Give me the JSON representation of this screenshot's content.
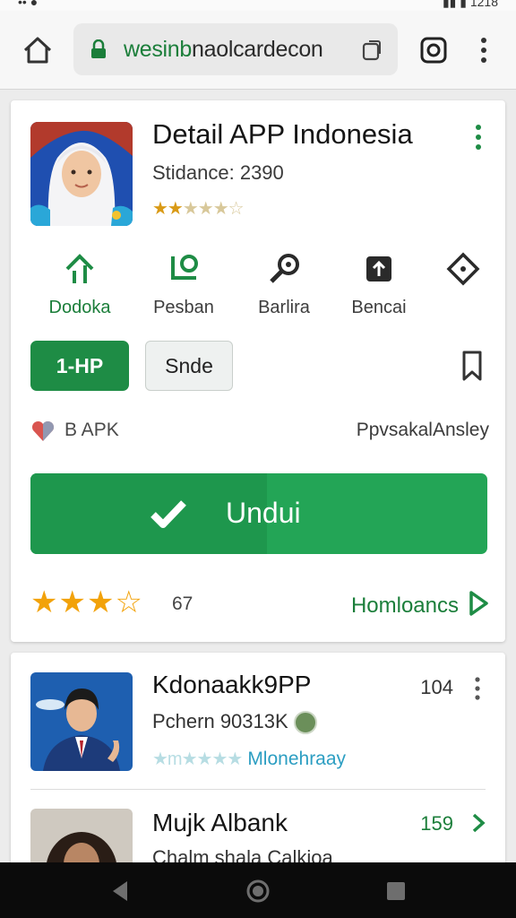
{
  "status_bar": {
    "left_text": "•• ●",
    "right_text": "▮▮ ▮ 1218"
  },
  "browser": {
    "url_host": "wesinb",
    "url_rest": "naolcardecon"
  },
  "app": {
    "title": "Detail APP Indonesia",
    "subtitle": "Stidance: 2390",
    "stars_filled": "★★",
    "stars_empty": "★★★☆"
  },
  "actions": [
    {
      "label": "Dodoka",
      "icon": "home-arrow-icon"
    },
    {
      "label": "Pesban",
      "icon": "pin-icon"
    },
    {
      "label": "Barlira",
      "icon": "key-icon"
    },
    {
      "label": "Bencai",
      "icon": "upload-icon"
    },
    {
      "label": "",
      "icon": "diamond-icon"
    }
  ],
  "buttons": {
    "primary_small": "1-HP",
    "secondary": "Snde"
  },
  "meta": {
    "left": "B APK",
    "right": "PpvsakalAnsley"
  },
  "download": {
    "label": "Undui"
  },
  "rating": {
    "stars": "★★★",
    "half_star": "☆",
    "count": "67",
    "homepage_label": "Homloancs"
  },
  "list": [
    {
      "name": "Kdonaakk9PP",
      "sub": "Pchern 90313K",
      "number": "104",
      "stars": "★m★★★★",
      "developer": "Mlonehraay"
    },
    {
      "name": "Mujk Albank",
      "sub": "Chalm shala Calkioa",
      "number": "159"
    }
  ],
  "colors": {
    "green": "#1e8c45",
    "download": "#23a556",
    "star": "#f2a20a",
    "link_green": "#1b7e3a"
  }
}
